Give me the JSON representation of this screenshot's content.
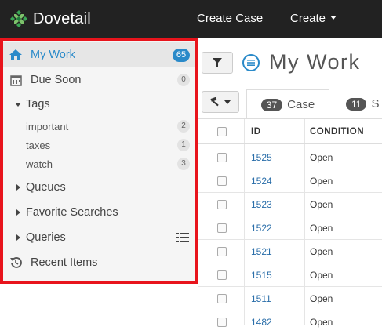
{
  "app": {
    "brand": "Dovetail",
    "nav": {
      "create_case": "Create Case",
      "create": "Create"
    }
  },
  "sidebar": {
    "my_work": {
      "label": "My Work",
      "count": "65"
    },
    "due_soon": {
      "label": "Due Soon",
      "count": "0"
    },
    "tags": {
      "label": "Tags",
      "items": [
        {
          "label": "important",
          "count": "2"
        },
        {
          "label": "taxes",
          "count": "1"
        },
        {
          "label": "watch",
          "count": "3"
        }
      ]
    },
    "queues": {
      "label": "Queues"
    },
    "favorite_searches": {
      "label": "Favorite Searches"
    },
    "queries": {
      "label": "Queries"
    },
    "recent_items": {
      "label": "Recent Items"
    }
  },
  "main": {
    "title": "My Work",
    "tabs": [
      {
        "count": "37",
        "label": "Case"
      },
      {
        "count": "11",
        "label": "S"
      }
    ],
    "table": {
      "headers": {
        "id": "ID",
        "condition": "CONDITION"
      },
      "rows": [
        {
          "id": "1525",
          "condition": "Open"
        },
        {
          "id": "1524",
          "condition": "Open"
        },
        {
          "id": "1523",
          "condition": "Open"
        },
        {
          "id": "1522",
          "condition": "Open"
        },
        {
          "id": "1521",
          "condition": "Open"
        },
        {
          "id": "1515",
          "condition": "Open"
        },
        {
          "id": "1511",
          "condition": "Open"
        },
        {
          "id": "1482",
          "condition": "Open"
        }
      ]
    }
  },
  "colors": {
    "accent": "#2a8ac9",
    "highlight_border": "#e8141c",
    "navbar": "#222222"
  }
}
